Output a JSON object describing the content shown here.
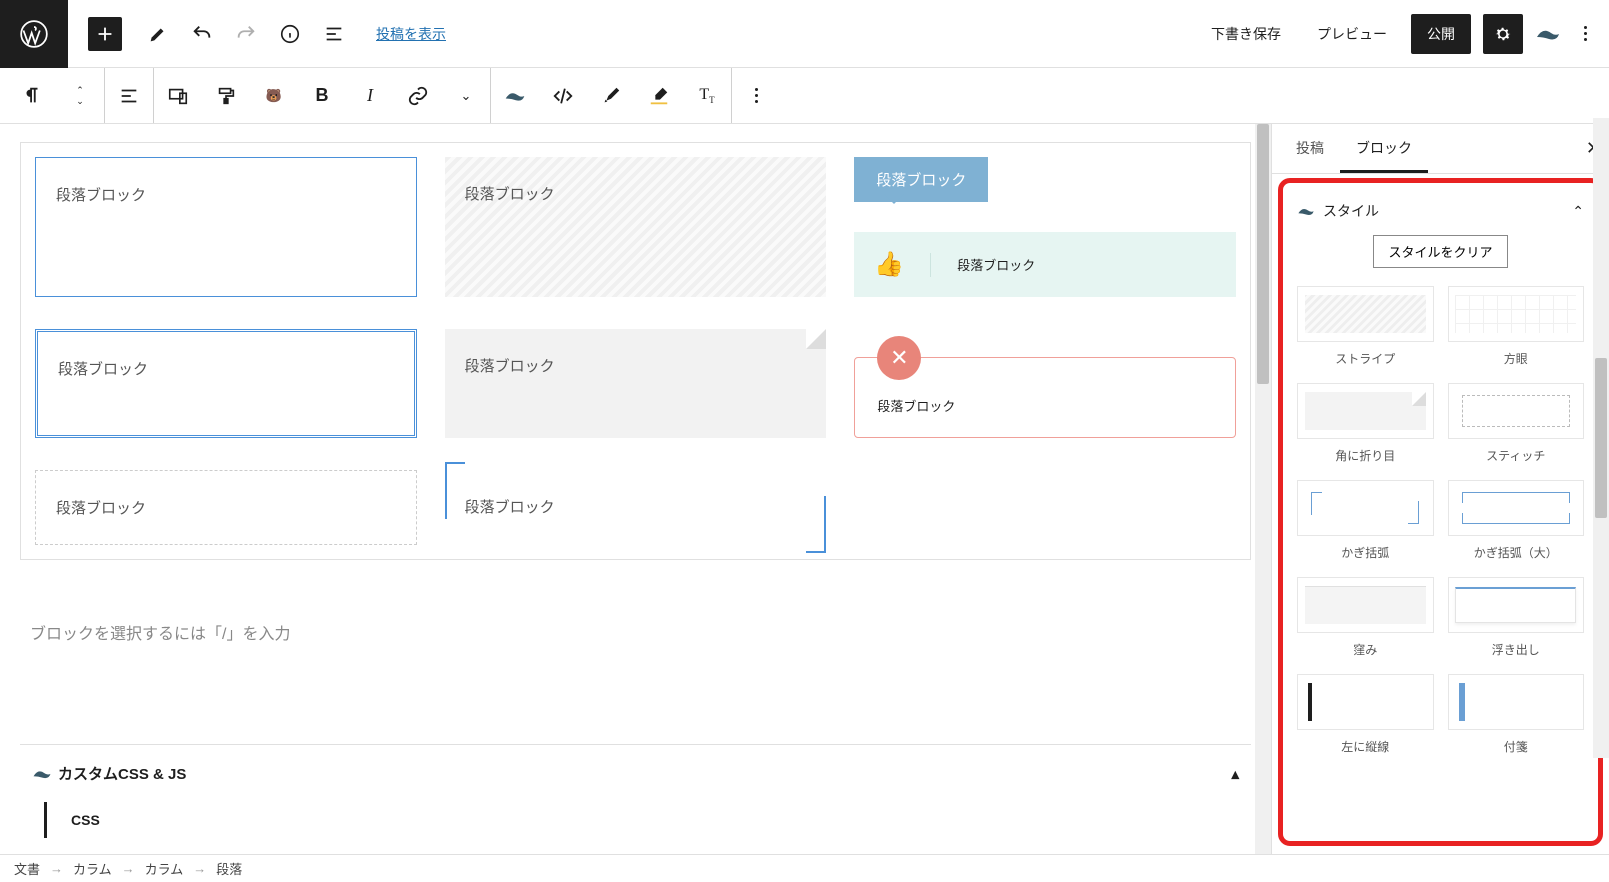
{
  "header": {
    "view_post": "投稿を表示",
    "save_draft": "下書き保存",
    "preview": "プレビュー",
    "publish": "公開"
  },
  "blocks": {
    "p1": "段落ブロック",
    "p2": "段落ブロック",
    "p3": "段落ブロック",
    "p4": "段落ブロック",
    "p5": "段落ブロック",
    "p6": "段落ブロック",
    "p7": "段落ブロック",
    "p8": "段落ブロック",
    "p9": "段落ブロック"
  },
  "placeholder": "ブロックを選択するには「/」を入力",
  "css_panel": {
    "title": "カスタムCSS & JS",
    "tab": "CSS"
  },
  "sidebar": {
    "tab_post": "投稿",
    "tab_block": "ブロック",
    "style_header": "スタイル",
    "clear": "スタイルをクリア",
    "styles": {
      "stripe": "ストライプ",
      "grid": "方眼",
      "fold": "角に折り目",
      "stitch": "スティッチ",
      "bracket": "かぎ括弧",
      "bracket_lg": "かぎ括弧（大）",
      "dent": "窪み",
      "float": "浮き出し",
      "leftline": "左に縦線",
      "sticky": "付箋"
    }
  },
  "breadcrumb": {
    "b1": "文書",
    "b2": "カラム",
    "b3": "カラム",
    "b4": "段落"
  }
}
